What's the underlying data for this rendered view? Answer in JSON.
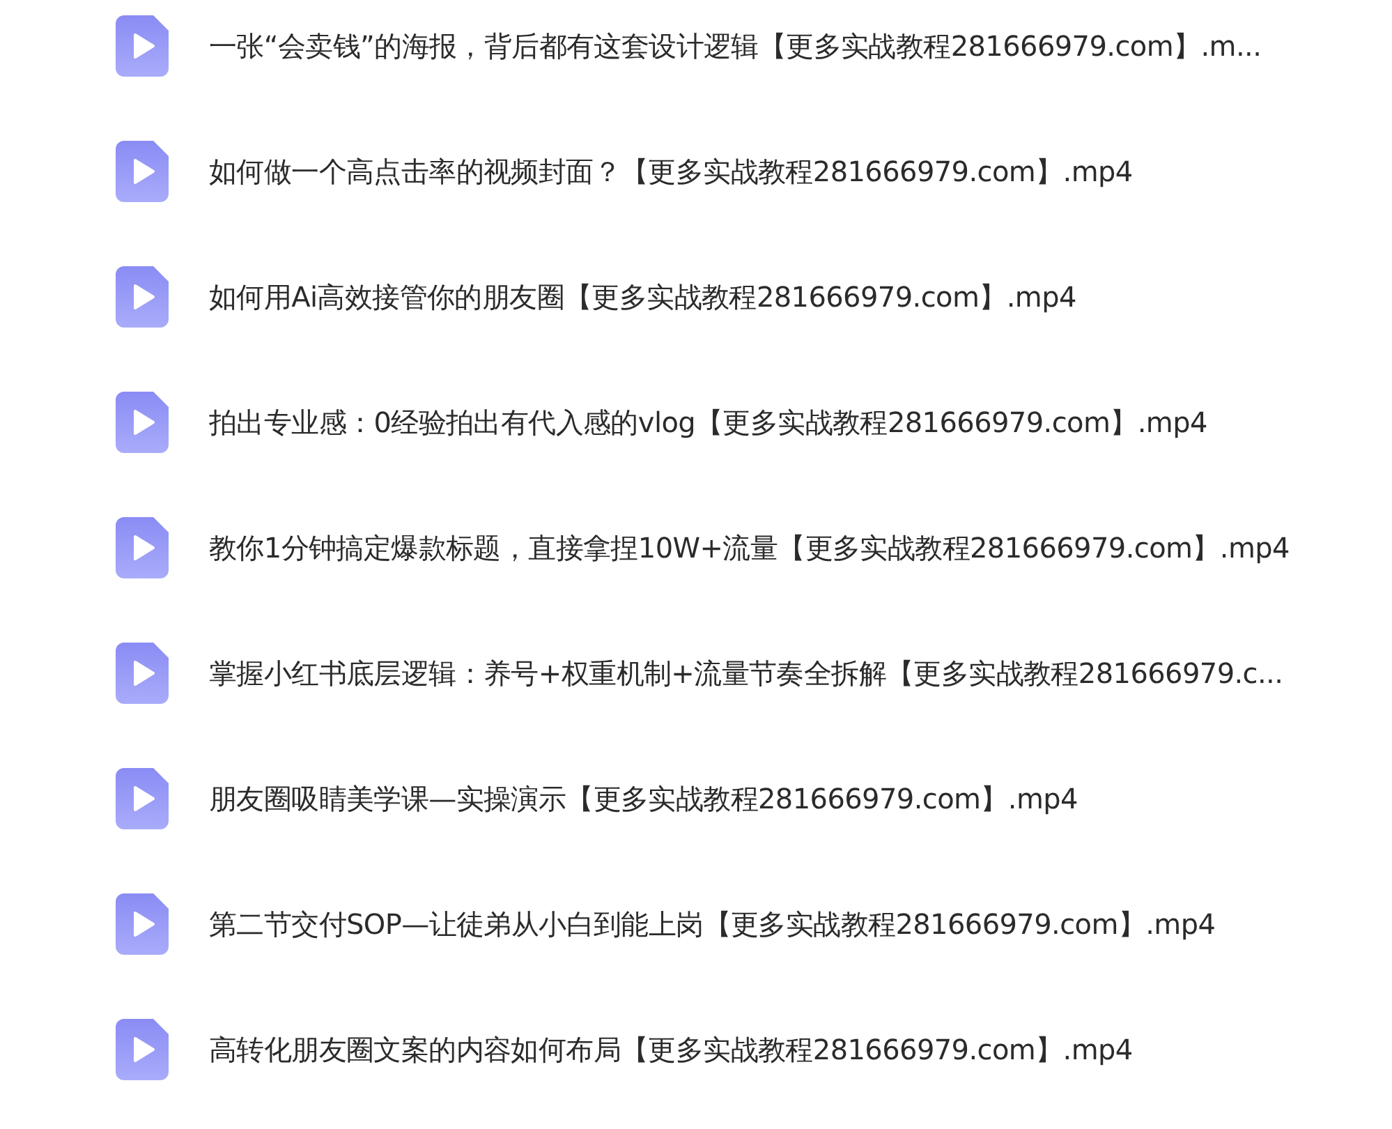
{
  "files": [
    {
      "name": "一张“会卖钱”的海报，背后都有这套设计逻辑【更多实战教程281666979.com】.m..."
    },
    {
      "name": "如何做一个高点击率的视频封面？【更多实战教程281666979.com】.mp4"
    },
    {
      "name": "如何用Ai高效接管你的朋友圈【更多实战教程281666979.com】.mp4"
    },
    {
      "name": "拍出专业感：0经验拍出有代入感的vlog【更多实战教程281666979.com】.mp4"
    },
    {
      "name": "教你1分钟搞定爆款标题，直接拿捏10W+流量【更多实战教程281666979.com】.mp4"
    },
    {
      "name": "掌握小红书底层逻辑：养号+权重机制+流量节奏全拆解【更多实战教程281666979.c..."
    },
    {
      "name": "朋友圈吸睛美学课—实操演示【更多实战教程281666979.com】.mp4"
    },
    {
      "name": "第二节交付SOP—让徒弟从小白到能上岗【更多实战教程281666979.com】.mp4"
    },
    {
      "name": "高转化朋友圈文案的内容如何布局【更多实战教程281666979.com】.mp4"
    }
  ]
}
